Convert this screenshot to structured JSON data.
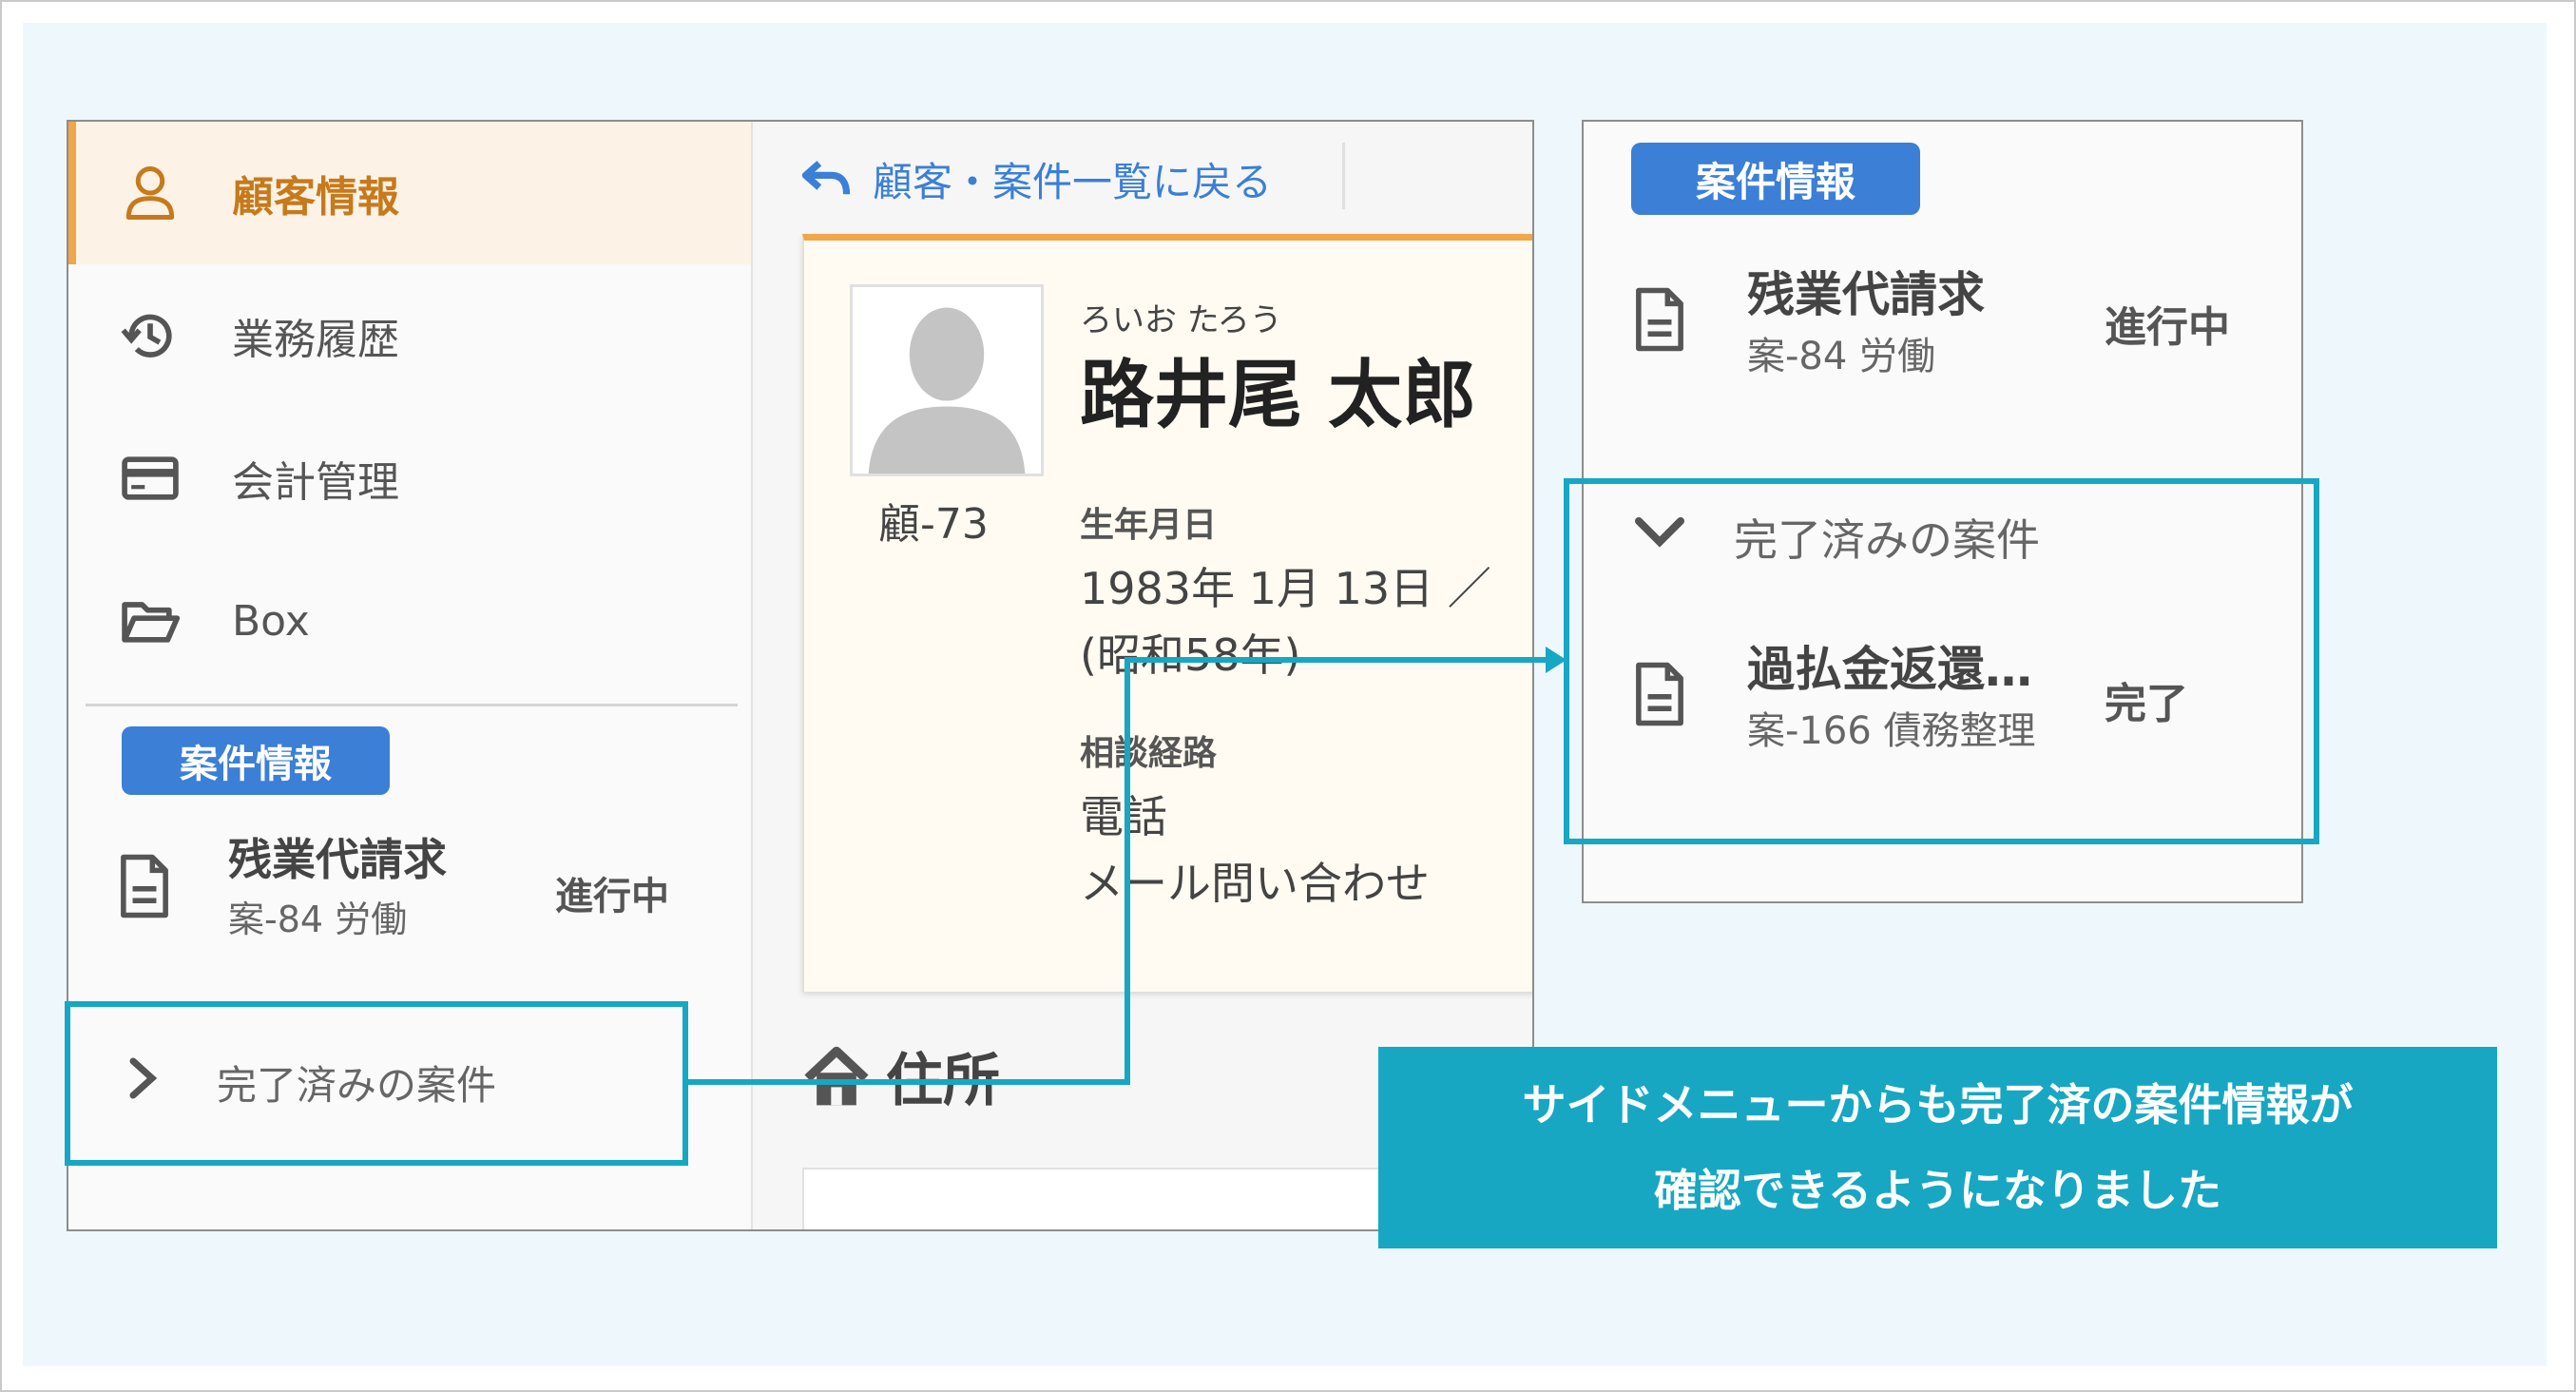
{
  "sidebar": {
    "items": [
      {
        "label": "顧客情報",
        "icon": "person-icon",
        "active": true
      },
      {
        "label": "業務履歴",
        "icon": "history-icon",
        "active": false
      },
      {
        "label": "会計管理",
        "icon": "credit-card-icon",
        "active": false
      },
      {
        "label": "Box",
        "icon": "folder-open-icon",
        "active": false
      }
    ],
    "case_badge": "案件情報",
    "case": {
      "title": "残業代請求",
      "sub": "案-84 労働",
      "status": "進行中"
    },
    "completed_label": "完了済みの案件"
  },
  "content": {
    "back_label": "顧客・案件一覧に戻る",
    "customer": {
      "ruby": "ろいお たろう",
      "name": "路井尾 太郎",
      "number": "顧-73",
      "birth_label": "生年月日",
      "birth_value": "1983年 1月 13日 ／ ",
      "birth_era": "(昭和58年)",
      "route_label": "相談経路",
      "route_values": [
        "電話",
        "メール問い合わせ"
      ]
    },
    "address_title": "住所"
  },
  "panel": {
    "case_badge": "案件情報",
    "active_case": {
      "title": "残業代請求",
      "sub": "案-84 労働",
      "status": "進行中"
    },
    "completed_label": "完了済みの案件",
    "completed_case": {
      "title": "過払金返還…",
      "sub": "案-166 債務整理",
      "status": "完了"
    }
  },
  "callout": {
    "line1": "サイドメニューからも完了済の案件情報が",
    "line2": "確認できるようになりました"
  },
  "colors": {
    "accent": "#17a7c2",
    "badge": "#3b7fd6",
    "active": "#f0a64a",
    "background": "#eef8fc"
  }
}
